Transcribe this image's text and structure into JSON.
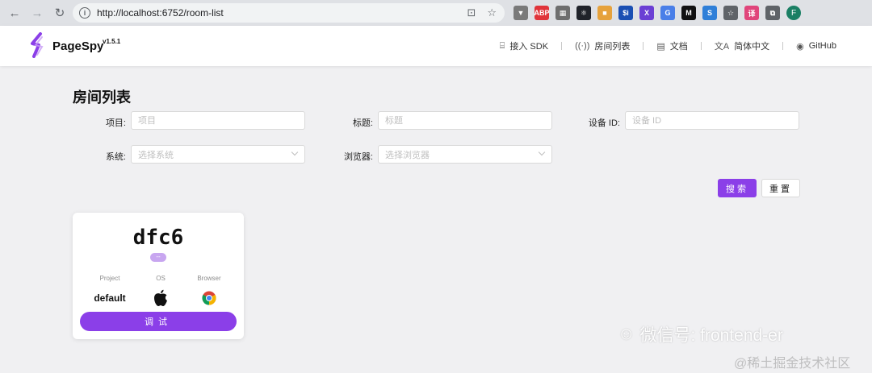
{
  "browser": {
    "url": "http://localhost:6752/room-list",
    "profile_initial": "F",
    "extensions": [
      {
        "name": "vpn-icon",
        "label": "▼",
        "color": "#7a7a7a"
      },
      {
        "name": "adblock-icon",
        "label": "ABP",
        "color": "#e0343a"
      },
      {
        "name": "grid-extension-icon",
        "label": "▦",
        "color": "#6e6e6e"
      },
      {
        "name": "react-devtools-icon",
        "label": "⚛",
        "color": "#20232a"
      },
      {
        "name": "color-extension-icon",
        "label": "■",
        "color": "#e6a23c"
      },
      {
        "name": "si-extension-icon",
        "label": "$i",
        "color": "#1a4fb3"
      },
      {
        "name": "x-extension-icon",
        "label": "X",
        "color": "#6b3fd4"
      },
      {
        "name": "translate-extension-icon",
        "label": "G",
        "color": "#4a7fe8"
      },
      {
        "name": "m-extension-icon",
        "label": "M",
        "color": "#111111"
      },
      {
        "name": "s-extension-icon",
        "label": "S",
        "color": "#2f7fd8"
      },
      {
        "name": "star-extension-icon",
        "label": "☆",
        "color": "#5f6368"
      },
      {
        "name": "pink-extension-icon",
        "label": "译",
        "color": "#e0457b"
      },
      {
        "name": "puzzle-extensions-icon",
        "label": "⧉",
        "color": "#5f6368"
      }
    ]
  },
  "header": {
    "brand": "PageSpy",
    "version": "v1.5.1",
    "nav": [
      {
        "name": "nav-sdk",
        "icon": "⌸",
        "label": "接入 SDK"
      },
      {
        "name": "nav-room-list",
        "icon": "((·))",
        "label": "房间列表"
      },
      {
        "name": "nav-docs",
        "icon": "▤",
        "label": "文档"
      },
      {
        "name": "nav-language",
        "icon": "文A",
        "label": "简体中文"
      },
      {
        "name": "nav-github",
        "icon": "◉",
        "label": "GitHub"
      }
    ]
  },
  "page": {
    "title": "房间列表",
    "filters": {
      "project_label": "项目:",
      "project_placeholder": "项目",
      "title_label": "标题:",
      "title_placeholder": "标题",
      "device_label": "设备 ID:",
      "device_placeholder": "设备 ID",
      "system_label": "系统:",
      "system_placeholder": "选择系统",
      "browser_label": "浏览器:",
      "browser_placeholder": "选择浏览器"
    },
    "search_label": "搜索",
    "reset_label": "重置"
  },
  "room_card": {
    "device_id": "dfc6",
    "tag": "--",
    "project_label": "Project",
    "project_value": "default",
    "os_label": "OS",
    "os_icon": "apple-icon",
    "browser_label": "Browser",
    "browser_icon": "chrome-icon",
    "debug_label": "调试"
  },
  "watermarks": {
    "wechat": "微信号: frontend-er",
    "juejin": "@稀土掘金技术社区"
  },
  "colors": {
    "accent": "#8b3fe8",
    "background": "#f0f0f2"
  }
}
